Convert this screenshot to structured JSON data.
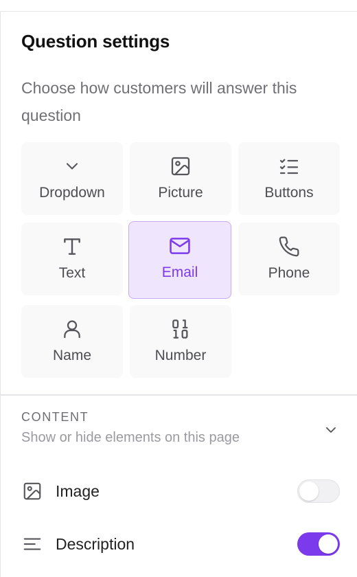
{
  "panel": {
    "title": "Question settings",
    "subtitle": "Choose how customers will answer this question"
  },
  "answer_types": [
    {
      "label": "Dropdown",
      "icon": "chevron-down-icon",
      "selected": false
    },
    {
      "label": "Picture",
      "icon": "image-icon",
      "selected": false
    },
    {
      "label": "Buttons",
      "icon": "checklist-icon",
      "selected": false
    },
    {
      "label": "Text",
      "icon": "text-icon",
      "selected": false
    },
    {
      "label": "Email",
      "icon": "mail-icon",
      "selected": true
    },
    {
      "label": "Phone",
      "icon": "phone-icon",
      "selected": false
    },
    {
      "label": "Name",
      "icon": "user-icon",
      "selected": false
    },
    {
      "label": "Number",
      "icon": "binary-icon",
      "selected": false
    }
  ],
  "content": {
    "heading": "CONTENT",
    "description": "Show or hide elements on this page",
    "toggles": [
      {
        "label": "Image",
        "icon": "image-icon",
        "on": false
      },
      {
        "label": "Description",
        "icon": "align-left-icon",
        "on": true
      }
    ]
  },
  "colors": {
    "accent": "#7c3aed",
    "selected_bg": "#efe5fd",
    "tile_bg": "#f9f9fa"
  }
}
